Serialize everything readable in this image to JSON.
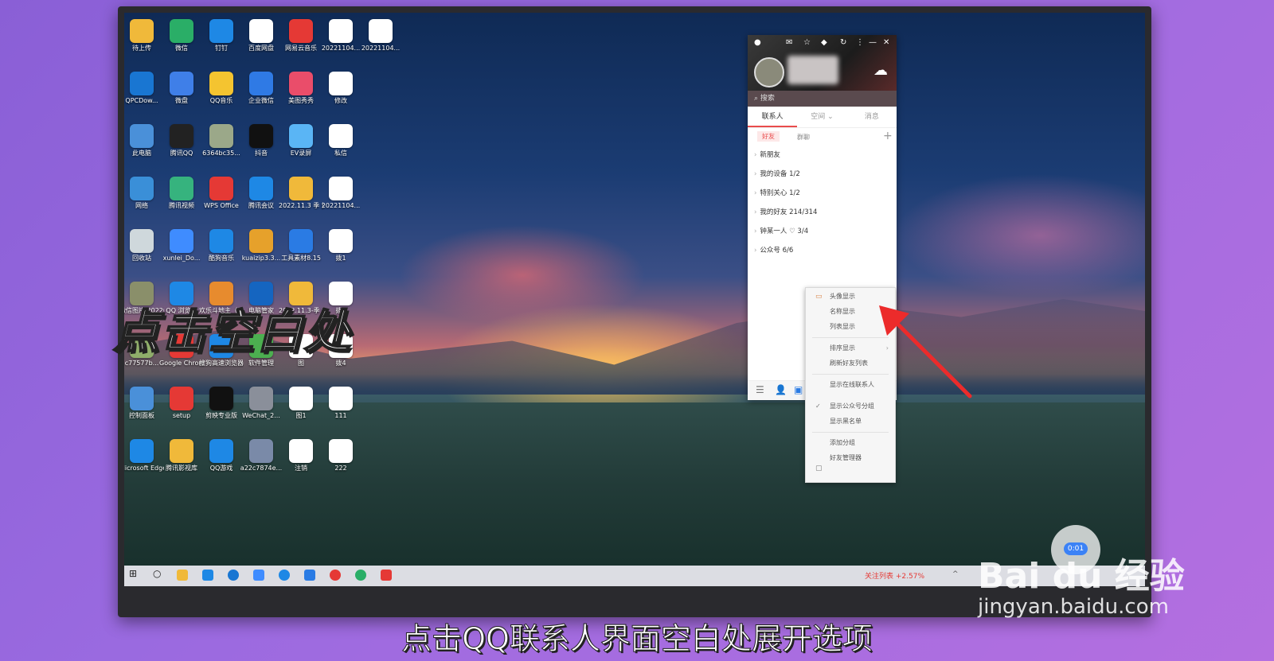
{
  "desktop": {
    "icons": [
      {
        "label": "待上传",
        "color": "#f0b93a"
      },
      {
        "label": "微信",
        "color": "#2aae67"
      },
      {
        "label": "钉钉",
        "color": "#1e88e5"
      },
      {
        "label": "百度网盘",
        "color": "#ffffff"
      },
      {
        "label": "网易云音乐",
        "color": "#e53935"
      },
      {
        "label": "20221104...",
        "color": "#ffffff"
      },
      {
        "label": "20221104...",
        "color": "#ffffff"
      },
      {
        "label": "QPCDow...",
        "color": "#1976d2"
      },
      {
        "label": "微盘",
        "color": "#3f7fe8"
      },
      {
        "label": "QQ音乐",
        "color": "#f4c430"
      },
      {
        "label": "企业微信",
        "color": "#2f7ae5"
      },
      {
        "label": "美图秀秀",
        "color": "#ea4d6a"
      },
      {
        "label": "修改",
        "color": "#ffffff"
      },
      {
        "label": "此电脑",
        "color": "#4a90d9"
      },
      {
        "label": "腾讯QQ",
        "color": "#222222"
      },
      {
        "label": "6364bc35...",
        "color": "#9ba889"
      },
      {
        "label": "抖音",
        "color": "#111111"
      },
      {
        "label": "EV录屏",
        "color": "#5ab5f5"
      },
      {
        "label": "私信",
        "color": "#ffffff"
      },
      {
        "label": "网络",
        "color": "#3a8fd8"
      },
      {
        "label": "腾讯视频",
        "color": "#36b37e"
      },
      {
        "label": "WPS Office",
        "color": "#e53935"
      },
      {
        "label": "腾讯会议",
        "color": "#1e88e5"
      },
      {
        "label": "2022.11.3 季 访谈",
        "color": "#f0b93a"
      },
      {
        "label": "20221104...",
        "color": "#ffffff"
      },
      {
        "label": "回收站",
        "color": "#cfd8dc"
      },
      {
        "label": "xunlei_Do...",
        "color": "#3f8cff"
      },
      {
        "label": "酷狗音乐",
        "color": "#1e88e5"
      },
      {
        "label": "kuaizip3.3...",
        "color": "#e6a12b"
      },
      {
        "label": "工具素材8.15",
        "color": "#2a7be4"
      },
      {
        "label": "拨1",
        "color": "#ffffff"
      },
      {
        "label": "微信图片 2022050...",
        "color": "#8a8f6a"
      },
      {
        "label": "QQ 浏览器",
        "color": "#1e88e5"
      },
      {
        "label": "欢乐斗地主（手游电脑版）",
        "color": "#e78b2e"
      },
      {
        "label": "电脑管家",
        "color": "#1565c0"
      },
      {
        "label": "2022.11.3-季 季",
        "color": "#f0b93a"
      },
      {
        "label": "拨3",
        "color": "#ffffff"
      },
      {
        "label": "c77577b...",
        "color": "#8fae6a"
      },
      {
        "label": "Google Chrome",
        "color": "#e53935"
      },
      {
        "label": "搜狗高速浏览器",
        "color": "#1e88e5"
      },
      {
        "label": "软件管理",
        "color": "#4caf50"
      },
      {
        "label": "图",
        "color": "#ffffff"
      },
      {
        "label": "拨4",
        "color": "#ffffff"
      },
      {
        "label": "控制面板",
        "color": "#4a90d9"
      },
      {
        "label": "setup",
        "color": "#e53935"
      },
      {
        "label": "剪映专业版",
        "color": "#111111"
      },
      {
        "label": "WeChat_2...",
        "color": "#8a8f9a"
      },
      {
        "label": "图1",
        "color": "#ffffff"
      },
      {
        "label": "111",
        "color": "#ffffff"
      },
      {
        "label": "Microsoft Edge",
        "color": "#1e88e5"
      },
      {
        "label": "腾讯影视库",
        "color": "#f0b93a"
      },
      {
        "label": "QQ游戏",
        "color": "#1e88e5"
      },
      {
        "label": "a22c7874e...",
        "color": "#7a8aa8"
      },
      {
        "label": "注销",
        "color": "#ffffff"
      },
      {
        "label": "222",
        "color": "#ffffff"
      }
    ]
  },
  "qq": {
    "search_placeholder": "搜索",
    "tabs": [
      "联系人",
      "空间 ⌄",
      "消息"
    ],
    "subtabs": [
      "好友",
      "群聊"
    ],
    "add_label": "+",
    "groups": [
      {
        "label": "新朋友"
      },
      {
        "label": "我的设备 1/2"
      },
      {
        "label": "特别关心 1/2"
      },
      {
        "label": "我的好友 214/314"
      },
      {
        "label": "钟某一人 ♡ 3/4"
      },
      {
        "label": "公众号 6/6"
      }
    ]
  },
  "context_menu": {
    "items": [
      {
        "label": "头像显示"
      },
      {
        "label": "名称显示"
      },
      {
        "label": "列表显示",
        "arrow": "›"
      },
      {
        "label": "排序显示",
        "arrow": "›"
      },
      {
        "label": "刷新好友列表"
      },
      {
        "label": "显示在线联系人"
      },
      {
        "label": "显示公众号分组",
        "check": "✓"
      },
      {
        "label": "显示黑名单"
      },
      {
        "label": "添加分组"
      },
      {
        "label": "好友管理器"
      }
    ]
  },
  "taskbar": {
    "stock_text": "关注列表 +2.57%"
  },
  "overlay": {
    "caption": "点击空白处",
    "subtitle": "点击QQ联系人界面空白处展开选项",
    "watermark": "Bai du 经验",
    "watermark_url": "jingyan.baidu.com",
    "timer": "0:01"
  }
}
